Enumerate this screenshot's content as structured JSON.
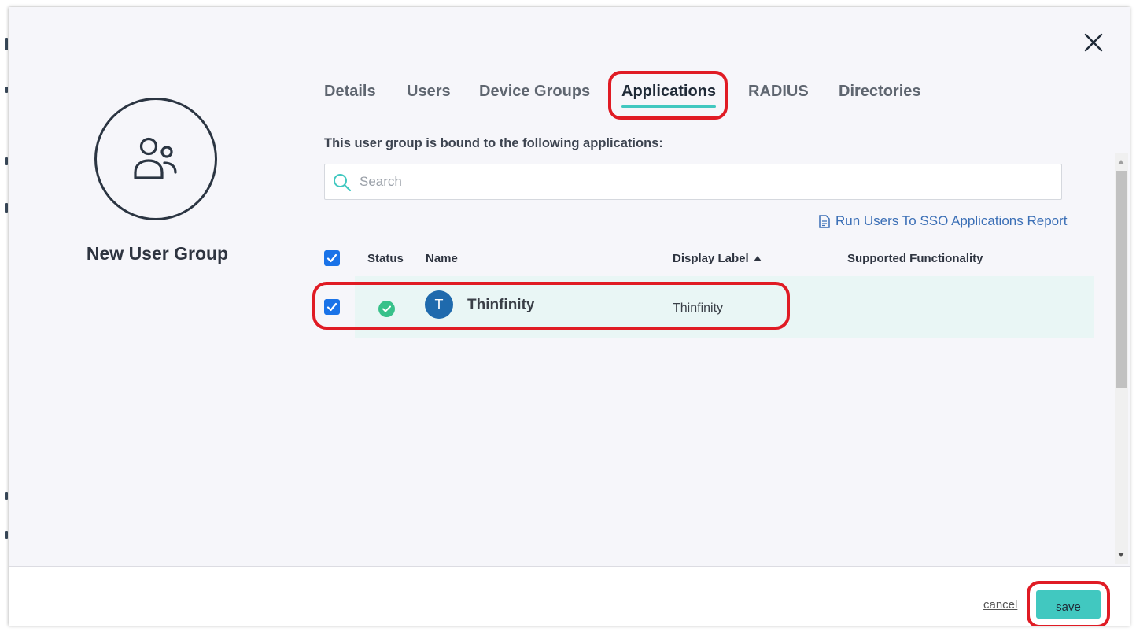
{
  "modal": {
    "group_name": "New User Group",
    "tabs": [
      {
        "label": "Details",
        "active": false
      },
      {
        "label": "Users",
        "active": false
      },
      {
        "label": "Device Groups",
        "active": false
      },
      {
        "label": "Applications",
        "active": true
      },
      {
        "label": "RADIUS",
        "active": false
      },
      {
        "label": "Directories",
        "active": false
      }
    ],
    "subtitle": "This user group is bound to the following applications:",
    "search": {
      "placeholder": "Search",
      "value": ""
    },
    "report_link": "Run Users To SSO Applications Report",
    "table": {
      "headers": {
        "status": "Status",
        "name": "Name",
        "display_label": "Display Label",
        "supported_functionality": "Supported Functionality"
      },
      "sort": {
        "column": "Display Label",
        "direction": "ascending"
      },
      "select_all_checked": true,
      "rows": [
        {
          "checked": true,
          "status": "active",
          "avatar_letter": "T",
          "name": "Thinfinity",
          "display_label": "Thinfinity",
          "supported_functionality": ""
        }
      ]
    },
    "footer": {
      "cancel_label": "cancel",
      "save_label": "save"
    }
  },
  "icons": {
    "close": "close-icon",
    "group": "user-group-icon",
    "search": "search-icon",
    "report": "document-icon",
    "status": "check-circle-icon",
    "sort": "sort-ascending-icon"
  },
  "colors": {
    "accent": "#41c8c0",
    "highlight": "#e01b24",
    "checkbox": "#1a73e8",
    "status_ok": "#38c18a",
    "link": "#3b6fb6",
    "app_avatar": "#1f6aad",
    "row_selected": "#e9f6f5"
  }
}
